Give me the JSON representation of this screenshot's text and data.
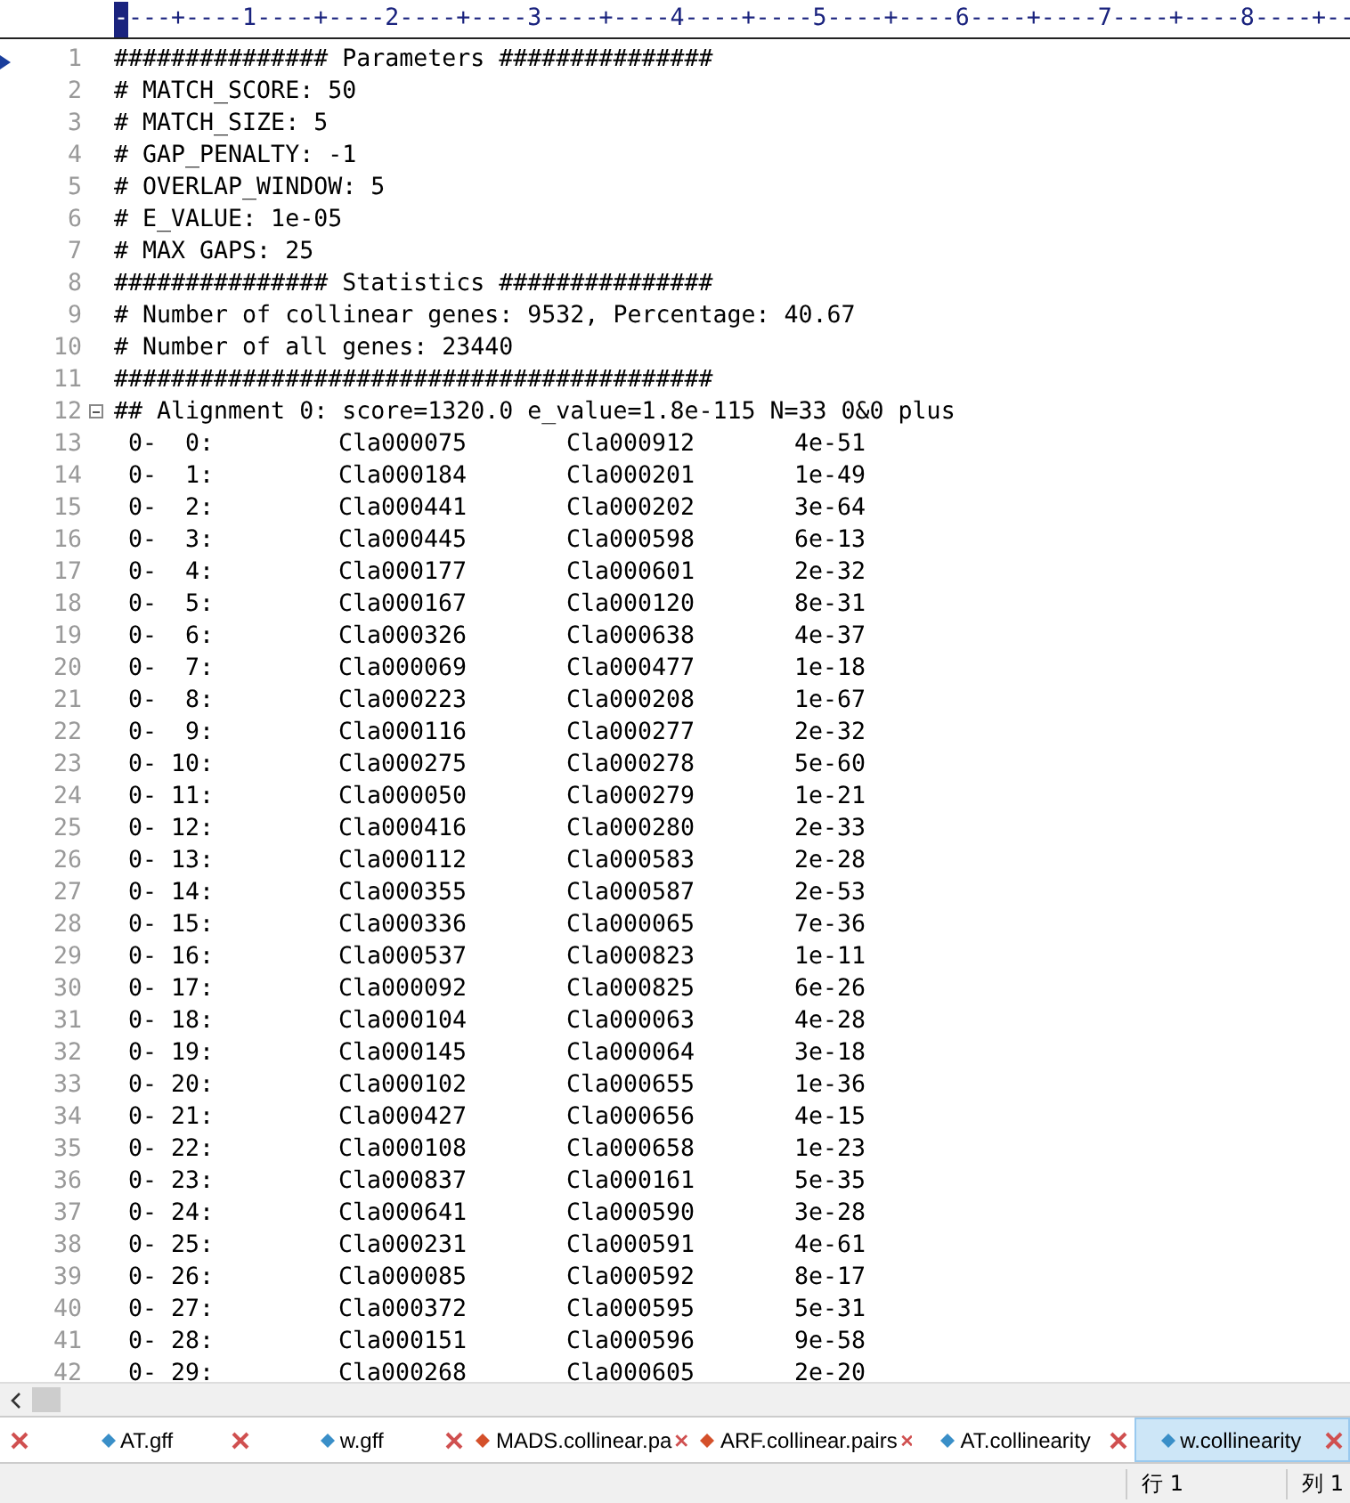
{
  "ruler": {
    "cursor": "-",
    "text": "---+----1----+----2----+----3----+----4----+----5----+----6----+----7----+----8----+--"
  },
  "editor": {
    "header_lines": [
      {
        "number": "1",
        "text": "############### Parameters ###############",
        "bookmark": true
      },
      {
        "number": "2",
        "text": "# MATCH_SCORE: 50"
      },
      {
        "number": "3",
        "text": "# MATCH_SIZE: 5"
      },
      {
        "number": "4",
        "text": "# GAP_PENALTY: -1"
      },
      {
        "number": "5",
        "text": "# OVERLAP_WINDOW: 5"
      },
      {
        "number": "6",
        "text": "# E_VALUE: 1e-05"
      },
      {
        "number": "7",
        "text": "# MAX GAPS: 25"
      },
      {
        "number": "8",
        "text": "############### Statistics ###############"
      },
      {
        "number": "9",
        "text": "# Number of collinear genes: 9532, Percentage: 40.67"
      },
      {
        "number": "10",
        "text": "# Number of all genes: 23440"
      },
      {
        "number": "11",
        "text": "##########################################"
      }
    ],
    "block": {
      "number": "12",
      "text": "## Alignment 0: score=1320.0 e_value=1.8e-115 N=33 0&0 plus",
      "expanded": true,
      "rows": [
        {
          "number": "13",
          "pair": "0-  0:",
          "gene_1": "Cla000075",
          "gene_2": "Cla000912",
          "e_value": "4e-51"
        },
        {
          "number": "14",
          "pair": "0-  1:",
          "gene_1": "Cla000184",
          "gene_2": "Cla000201",
          "e_value": "1e-49"
        },
        {
          "number": "15",
          "pair": "0-  2:",
          "gene_1": "Cla000441",
          "gene_2": "Cla000202",
          "e_value": "3e-64"
        },
        {
          "number": "16",
          "pair": "0-  3:",
          "gene_1": "Cla000445",
          "gene_2": "Cla000598",
          "e_value": "6e-13"
        },
        {
          "number": "17",
          "pair": "0-  4:",
          "gene_1": "Cla000177",
          "gene_2": "Cla000601",
          "e_value": "2e-32"
        },
        {
          "number": "18",
          "pair": "0-  5:",
          "gene_1": "Cla000167",
          "gene_2": "Cla000120",
          "e_value": "8e-31"
        },
        {
          "number": "19",
          "pair": "0-  6:",
          "gene_1": "Cla000326",
          "gene_2": "Cla000638",
          "e_value": "4e-37"
        },
        {
          "number": "20",
          "pair": "0-  7:",
          "gene_1": "Cla000069",
          "gene_2": "Cla000477",
          "e_value": "1e-18"
        },
        {
          "number": "21",
          "pair": "0-  8:",
          "gene_1": "Cla000223",
          "gene_2": "Cla000208",
          "e_value": "1e-67"
        },
        {
          "number": "22",
          "pair": "0-  9:",
          "gene_1": "Cla000116",
          "gene_2": "Cla000277",
          "e_value": "2e-32"
        },
        {
          "number": "23",
          "pair": "0- 10:",
          "gene_1": "Cla000275",
          "gene_2": "Cla000278",
          "e_value": "5e-60"
        },
        {
          "number": "24",
          "pair": "0- 11:",
          "gene_1": "Cla000050",
          "gene_2": "Cla000279",
          "e_value": "1e-21"
        },
        {
          "number": "25",
          "pair": "0- 12:",
          "gene_1": "Cla000416",
          "gene_2": "Cla000280",
          "e_value": "2e-33"
        },
        {
          "number": "26",
          "pair": "0- 13:",
          "gene_1": "Cla000112",
          "gene_2": "Cla000583",
          "e_value": "2e-28"
        },
        {
          "number": "27",
          "pair": "0- 14:",
          "gene_1": "Cla000355",
          "gene_2": "Cla000587",
          "e_value": "2e-53"
        },
        {
          "number": "28",
          "pair": "0- 15:",
          "gene_1": "Cla000336",
          "gene_2": "Cla000065",
          "e_value": "7e-36"
        },
        {
          "number": "29",
          "pair": "0- 16:",
          "gene_1": "Cla000537",
          "gene_2": "Cla000823",
          "e_value": "1e-11"
        },
        {
          "number": "30",
          "pair": "0- 17:",
          "gene_1": "Cla000092",
          "gene_2": "Cla000825",
          "e_value": "6e-26"
        },
        {
          "number": "31",
          "pair": "0- 18:",
          "gene_1": "Cla000104",
          "gene_2": "Cla000063",
          "e_value": "4e-28"
        },
        {
          "number": "32",
          "pair": "0- 19:",
          "gene_1": "Cla000145",
          "gene_2": "Cla000064",
          "e_value": "3e-18"
        },
        {
          "number": "33",
          "pair": "0- 20:",
          "gene_1": "Cla000102",
          "gene_2": "Cla000655",
          "e_value": "1e-36"
        },
        {
          "number": "34",
          "pair": "0- 21:",
          "gene_1": "Cla000427",
          "gene_2": "Cla000656",
          "e_value": "4e-15"
        },
        {
          "number": "35",
          "pair": "0- 22:",
          "gene_1": "Cla000108",
          "gene_2": "Cla000658",
          "e_value": "1e-23"
        },
        {
          "number": "36",
          "pair": "0- 23:",
          "gene_1": "Cla000837",
          "gene_2": "Cla000161",
          "e_value": "5e-35"
        },
        {
          "number": "37",
          "pair": "0- 24:",
          "gene_1": "Cla000641",
          "gene_2": "Cla000590",
          "e_value": "3e-28"
        },
        {
          "number": "38",
          "pair": "0- 25:",
          "gene_1": "Cla000231",
          "gene_2": "Cla000591",
          "e_value": "4e-61"
        },
        {
          "number": "39",
          "pair": "0- 26:",
          "gene_1": "Cla000085",
          "gene_2": "Cla000592",
          "e_value": "8e-17"
        },
        {
          "number": "40",
          "pair": "0- 27:",
          "gene_1": "Cla000372",
          "gene_2": "Cla000595",
          "e_value": "5e-31"
        },
        {
          "number": "41",
          "pair": "0- 28:",
          "gene_1": "Cla000151",
          "gene_2": "Cla000596",
          "e_value": "9e-58"
        },
        {
          "number": "42",
          "pair": "0- 29:",
          "gene_1": "Cla000268",
          "gene_2": "Cla000605",
          "e_value": "2e-20"
        }
      ]
    }
  },
  "tabs": [
    {
      "label": "AT.gff",
      "color": "#3a8fc8",
      "selected": false
    },
    {
      "label": "w.gff",
      "color": "#3a8fc8",
      "selected": false
    },
    {
      "label": "MADS.collinear.pa",
      "color": "#d4502a",
      "selected": false
    },
    {
      "label": "ARF.collinear.pairs",
      "color": "#d4502a",
      "selected": false
    },
    {
      "label": "AT.collinearity",
      "color": "#3a8fc8",
      "selected": false
    },
    {
      "label": "w.collinearity",
      "color": "#3a8fc8",
      "selected": true
    }
  ],
  "status_bar": {
    "line": "行 1",
    "column": "列 1"
  }
}
